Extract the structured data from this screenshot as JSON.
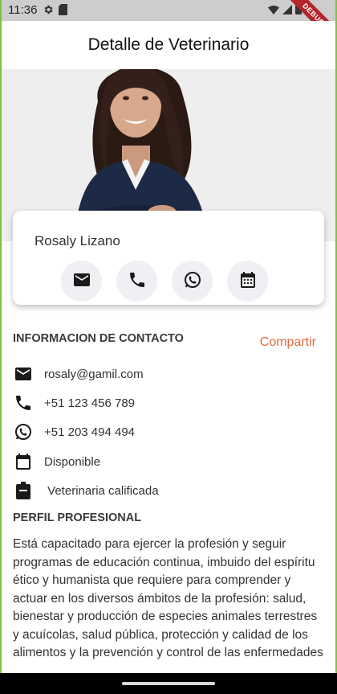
{
  "status_bar": {
    "time": "11:36",
    "left_icons": [
      "settings-icon",
      "sim-card-icon"
    ],
    "right_icons": [
      "wifi-icon",
      "signal-icon",
      "battery-icon"
    ]
  },
  "debug_banner": "DEBUG",
  "app_bar": {
    "title": "Detalle de Veterinario"
  },
  "profile": {
    "name": "Rosaly Lizano",
    "actions": [
      "email-icon",
      "phone-icon",
      "whatsapp-icon",
      "calendar-icon"
    ]
  },
  "contact": {
    "section_title": "INFORMACION DE CONTACTO",
    "share_label": "Compartir",
    "items": [
      {
        "icon": "email-icon",
        "text": "rosaly@gamil.com"
      },
      {
        "icon": "phone-icon",
        "text": "+51 123 456 789"
      },
      {
        "icon": "whatsapp-icon",
        "text": "+51 203 494 494"
      },
      {
        "icon": "calendar-icon",
        "text": "Disponible"
      },
      {
        "icon": "badge-icon",
        "text": " Veterinaria calificada"
      }
    ]
  },
  "profile_section": {
    "title": "PERFIL PROFESIONAL",
    "text": "Está capacitado para ejercer la profesión y seguir programas de educación continua, imbuido del espíritu ético y humanista que requiere para comprender y actuar en los diversos ámbitos de la profesión: salud, bienestar y producción de especies animales terrestres y acuícolas, salud pública, protección y calidad de los alimentos y la prevención y control de las enfermedades"
  },
  "colors": {
    "accent": "#e06a3d",
    "frame": "#7fc241",
    "button_bg": "#eef0f3"
  }
}
